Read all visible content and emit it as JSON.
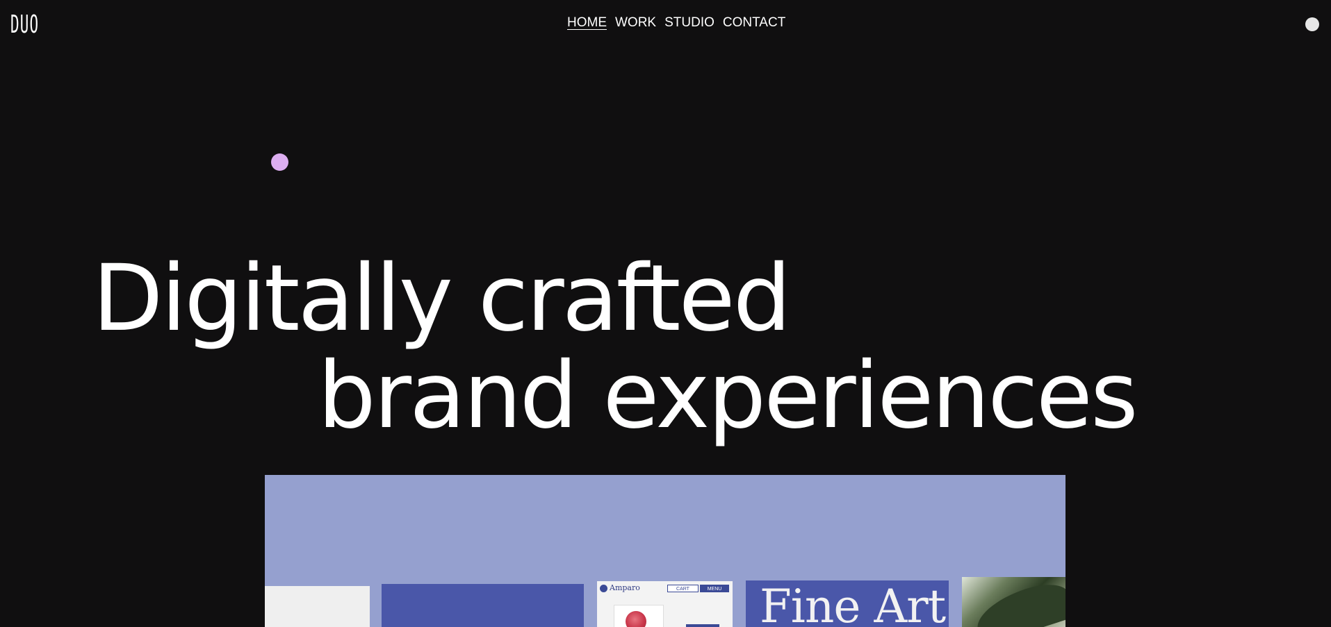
{
  "header": {
    "logo": "DUO",
    "nav": [
      {
        "label": "HOME",
        "active": true
      },
      {
        "label": "WORK",
        "active": false
      },
      {
        "label": "STUDIO",
        "active": false
      },
      {
        "label": "CONTACT",
        "active": false
      }
    ]
  },
  "hero": {
    "line1": "Digitally crafted",
    "line2": "brand experiences"
  },
  "showcase": {
    "cards": [
      {
        "kind": "blank-light"
      },
      {
        "kind": "blue-panel"
      },
      {
        "kind": "site-mockup",
        "brand": "Amparo",
        "cart_label": "CART",
        "menu_label": "MENU"
      },
      {
        "kind": "typography",
        "text": "Fine Art"
      },
      {
        "kind": "photo"
      }
    ]
  },
  "colors": {
    "background": "#100f10",
    "text": "#ffffff",
    "accent_dot": "#dcaef0",
    "showcase_bg": "#95a0cf",
    "brand_blue": "#4a57a9",
    "top_dot": "#e6e6e6"
  }
}
